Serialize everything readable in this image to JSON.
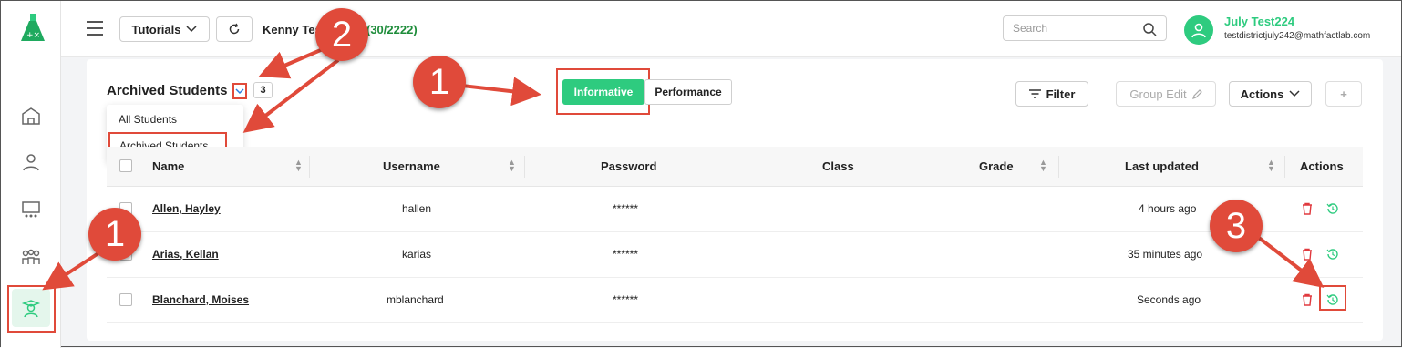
{
  "header": {
    "tutorials_label": "Tutorials",
    "user_line": "Kenny Test",
    "user_count": "(30/2222)",
    "search_placeholder": "Search",
    "user_name": "July Test224",
    "user_email": "testdistrictjuly242@mathfactlab.com"
  },
  "page": {
    "title": "Archived Students",
    "count": "3",
    "dropdown_options": [
      "All Students",
      "Archived Students"
    ],
    "tabs": [
      "Informative",
      "Performance"
    ],
    "filter_label": "Filter",
    "group_edit_label": "Group Edit",
    "actions_label": "Actions",
    "plus_label": "+"
  },
  "table": {
    "columns": [
      "Name",
      "Username",
      "Password",
      "Class",
      "Grade",
      "Last updated",
      "Actions"
    ],
    "rows": [
      {
        "name": "Allen, Hayley",
        "username": "hallen",
        "password": "******",
        "class": "",
        "grade": "",
        "updated": "4 hours ago"
      },
      {
        "name": "Arias, Kellan",
        "username": "karias",
        "password": "******",
        "class": "",
        "grade": "",
        "updated": "35 minutes ago"
      },
      {
        "name": "Blanchard, Moises",
        "username": "mblanchard",
        "password": "******",
        "class": "",
        "grade": "",
        "updated": "Seconds ago"
      }
    ]
  },
  "callouts": [
    "1",
    "2",
    "1",
    "3"
  ],
  "colors": {
    "accent": "#2ecb7f",
    "annotation": "#e04a3a",
    "delete": "#e0393e"
  },
  "icons": [
    "logo-icon",
    "school-icon",
    "gear-user-icon",
    "classroom-icon",
    "group-icon",
    "graduate-icon",
    "hamburger-icon",
    "chevron-down-icon",
    "refresh-icon",
    "search-icon",
    "avatar-icon",
    "filter-icon",
    "pencil-icon",
    "trash-icon",
    "restore-icon"
  ]
}
